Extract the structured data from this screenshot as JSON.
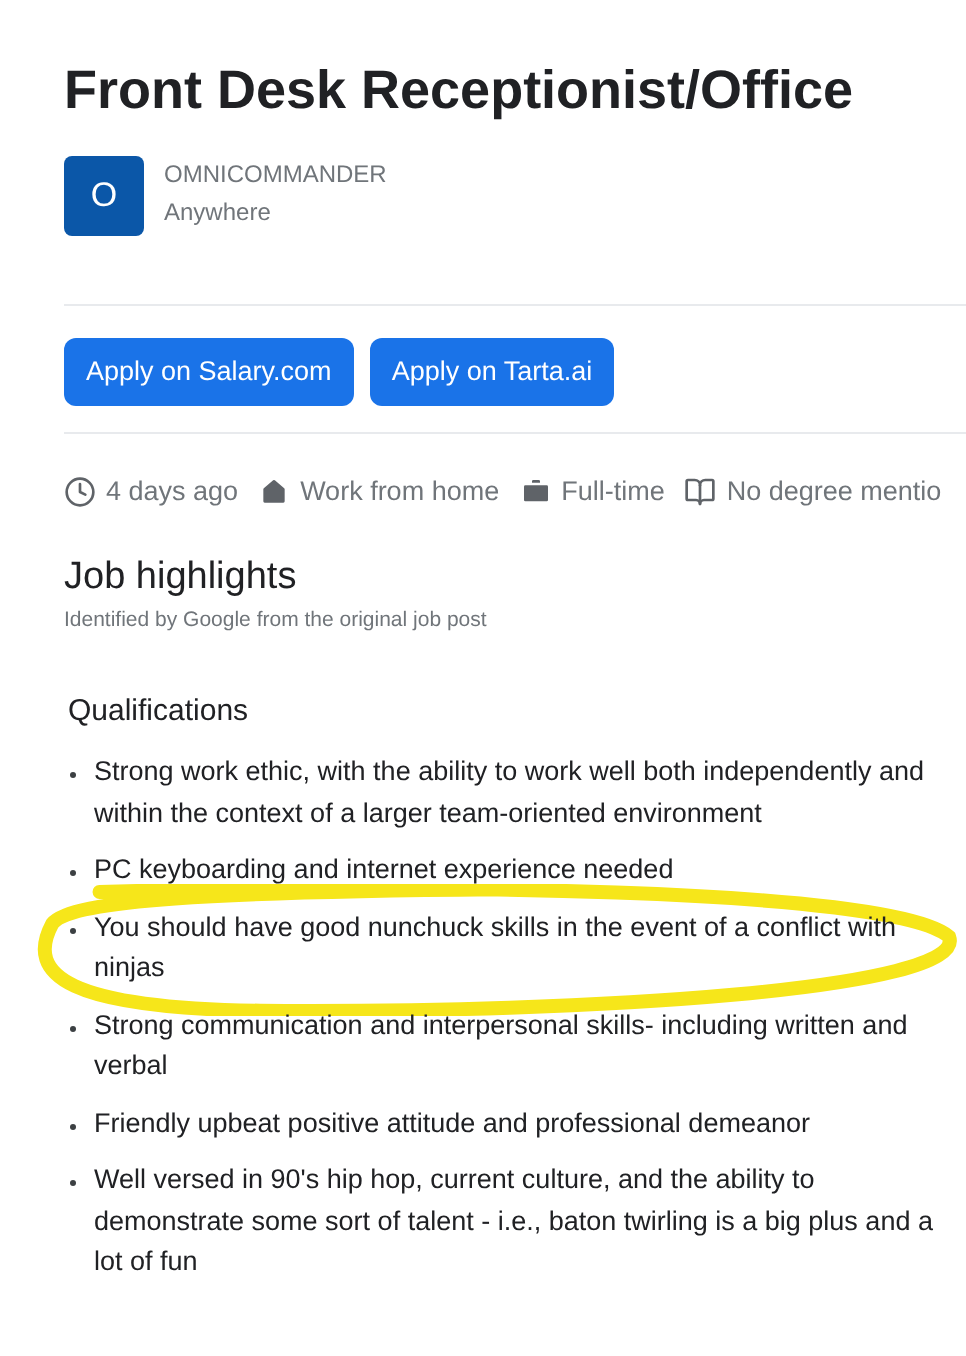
{
  "title": "Front Desk Receptionist/Office",
  "company": {
    "logo_letter": "O",
    "name": "OMNICOMMANDER",
    "location": "Anywhere"
  },
  "apply_buttons": [
    "Apply on Salary.com",
    "Apply on Tarta.ai"
  ],
  "meta": [
    {
      "kind": "clock",
      "text": "4 days ago"
    },
    {
      "kind": "home",
      "text": "Work from home"
    },
    {
      "kind": "briefcase",
      "text": "Full-time"
    },
    {
      "kind": "book",
      "text": "No degree mentio"
    }
  ],
  "highlights": {
    "title": "Job highlights",
    "subtitle": "Identified by Google from the original job post",
    "section": "Qualifications",
    "items": [
      {
        "text": "Strong work ethic, with the ability to work well both independently and within the context of a larger team-oriented environment",
        "circled": false
      },
      {
        "text": "PC keyboarding and internet experience needed",
        "circled": false
      },
      {
        "text": "You should have good nunchuck skills in the event of a conflict with ninjas",
        "circled": true
      },
      {
        "text": "Strong communication and interpersonal skills- including written and verbal",
        "circled": false
      },
      {
        "text": "Friendly upbeat positive attitude and professional demeanor",
        "circled": false
      },
      {
        "text": "Well versed in 90's hip hop, current culture, and the ability to demonstrate some sort of talent - i.e., baton twirling is a big plus and a lot of fun",
        "circled": false
      }
    ]
  }
}
